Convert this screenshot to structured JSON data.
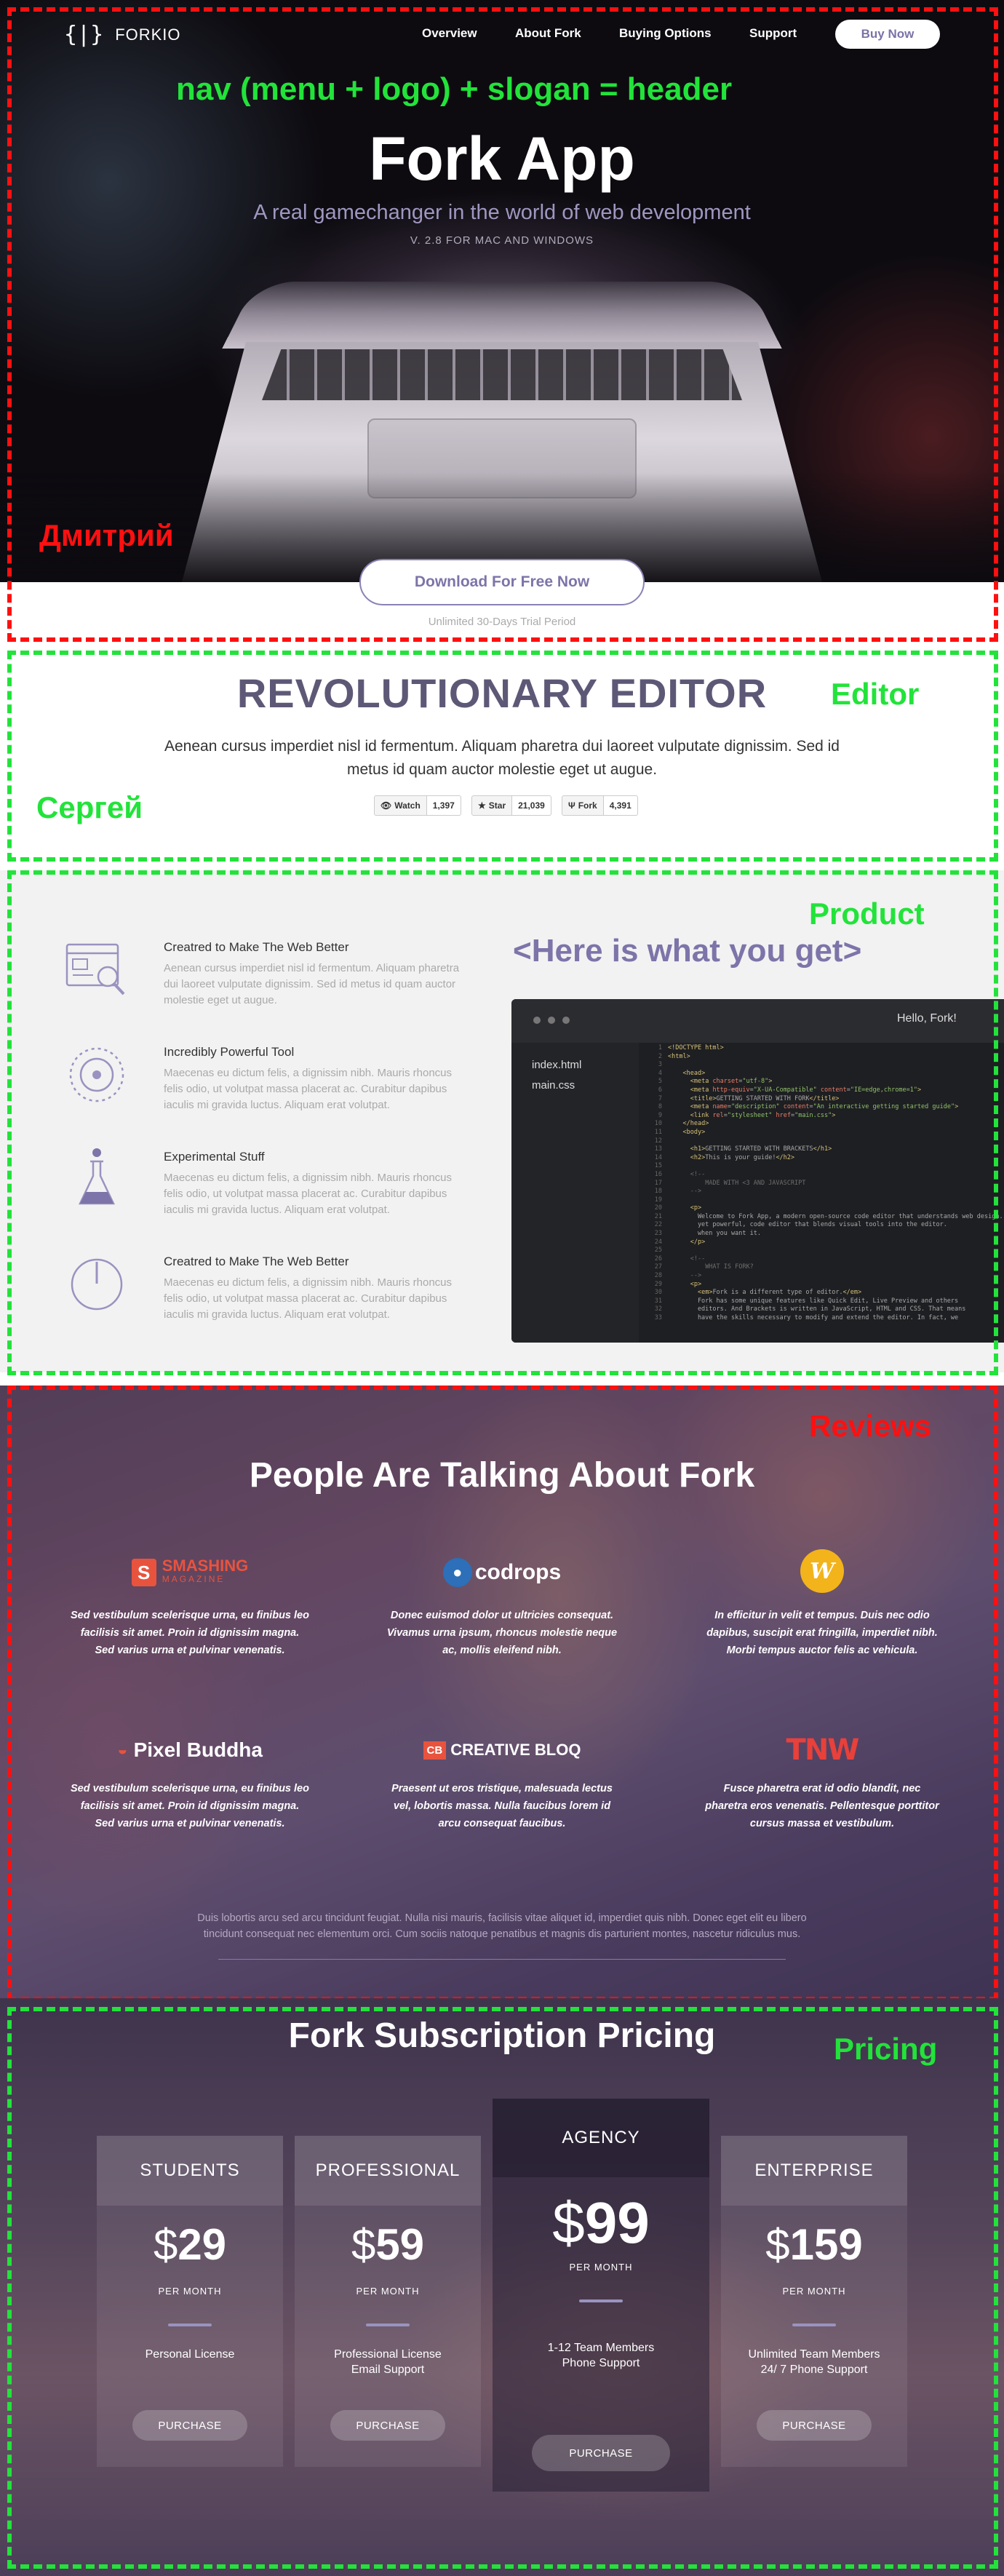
{
  "nav": {
    "logo_mark": "{|}",
    "logo_text": "FORKIO",
    "menu": [
      "Overview",
      "About Fork",
      "Buying Options",
      "Support"
    ],
    "buy_now": "Buy Now"
  },
  "annotations": {
    "header": "nav (menu + logo) + slogan = header",
    "header_author": "Дмитрий",
    "editor": "Editor",
    "editor_author": "Сергей",
    "product": "Product",
    "reviews": "Reviews",
    "pricing": "Pricing"
  },
  "hero": {
    "title": "Fork App",
    "subtitle": "A real gamechanger in the world of web development",
    "version": "V. 2.8 FOR MAC AND WINDOWS",
    "download": "Download For Free Now",
    "trial": "Unlimited 30-Days Trial Period"
  },
  "editor": {
    "title": "REVOLUTIONARY EDITOR",
    "text": "Aenean cursus imperdiet nisl id fermentum. Aliquam pharetra dui laoreet vulputate dignissim. Sed id metus id quam auctor molestie eget ut augue.",
    "github": [
      {
        "icon": "eye-icon",
        "label": "Watch",
        "count": "1,397"
      },
      {
        "icon": "star-icon",
        "label": "Star",
        "count": "21,039"
      },
      {
        "icon": "fork-icon",
        "label": "Fork",
        "count": "4,391"
      }
    ]
  },
  "product": {
    "heading": "<Here is what you get>",
    "features": [
      {
        "icon": "browser-magnifier-icon",
        "title": "Creatred to Make The Web Better",
        "text": "Aenean cursus imperdiet nisl id fermentum. Aliquam pharetra dui laoreet vulputate dignissim. Sed id metus id quam auctor molestie eget ut augue."
      },
      {
        "icon": "gauge-icon",
        "title": "Incredibly Powerful Tool",
        "text": "Maecenas eu dictum felis, a dignissim nibh. Mauris rhoncus felis odio, ut volutpat massa placerat ac. Curabitur dapibus iaculis mi gravida luctus. Aliquam erat volutpat."
      },
      {
        "icon": "flask-icon",
        "title": "Experimental Stuff",
        "text": "Maecenas eu dictum felis, a dignissim nibh. Mauris rhoncus felis odio, ut volutpat massa placerat ac. Curabitur dapibus iaculis mi gravida luctus. Aliquam erat volutpat."
      },
      {
        "icon": "power-icon",
        "title": "Creatred to Make The Web Better",
        "text": "Maecenas eu dictum felis, a dignissim nibh. Mauris rhoncus felis odio, ut volutpat massa placerat ac. Curabitur dapibus iaculis mi gravida luctus. Aliquam erat volutpat."
      }
    ],
    "window": {
      "title": "Hello, Fork!",
      "files": [
        "index.html",
        "main.css"
      ]
    }
  },
  "reviews": {
    "heading": "People Are Talking About Fork",
    "items": [
      {
        "logo": "SMASHING",
        "logo_sub": "MAGAZINE",
        "text": "Sed vestibulum scelerisque urna, eu finibus leo facilisis sit amet. Proin id dignissim magna. Sed varius urna et pulvinar venenatis."
      },
      {
        "logo": "codrops",
        "logo_sub": "",
        "text": "Donec euismod dolor ut ultricies consequat. Vivamus urna ipsum, rhoncus molestie neque ac, mollis eleifend nibh."
      },
      {
        "logo": "W",
        "logo_sub": "",
        "text": "In efficitur in velit et tempus. Duis nec odio dapibus, suscipit erat fringilla, imperdiet nibh. Morbi tempus auctor felis ac vehicula."
      },
      {
        "logo": "Pixel Buddha",
        "logo_sub": "",
        "text": "Sed vestibulum scelerisque urna, eu finibus leo facilisis sit amet. Proin id dignissim magna. Sed varius urna et pulvinar venenatis."
      },
      {
        "logo": "CREATIVE BLOQ",
        "logo_sub": "CB",
        "text": "Praesent ut eros tristique, malesuada lectus vel, lobortis massa. Nulla faucibus lorem id arcu consequat faucibus."
      },
      {
        "logo": "TNW",
        "logo_sub": "",
        "text": "Fusce pharetra erat id odio blandit, nec pharetra eros venenatis. Pellentesque porttitor cursus massa et vestibulum."
      }
    ],
    "footnote": "Duis lobortis arcu sed arcu tincidunt feugiat. Nulla nisi mauris, facilisis vitae aliquet id, imperdiet quis nibh. Donec eget elit eu libero tincidunt consequat nec elementum orci. Cum sociis natoque penatibus et magnis dis parturient montes, nascetur ridiculus mus."
  },
  "pricing": {
    "heading": "Fork Subscription Pricing",
    "plans": [
      {
        "name": "STUDENTS",
        "currency": "$",
        "price": "29",
        "period": "PER MONTH",
        "desc": [
          "Personal License"
        ],
        "cta": "PURCHASE"
      },
      {
        "name": "PROFESSIONAL",
        "currency": "$",
        "price": "59",
        "period": "PER MONTH",
        "desc": [
          "Professional License",
          "Email Support"
        ],
        "cta": "PURCHASE"
      },
      {
        "name": "AGENCY",
        "currency": "$",
        "price": "99",
        "period": "PER MONTH",
        "desc": [
          "1-12 Team Members",
          "Phone Support"
        ],
        "cta": "PURCHASE"
      },
      {
        "name": "ENTERPRISE",
        "currency": "$",
        "price": "159",
        "period": "PER MONTH",
        "desc": [
          "Unlimited Team Members",
          "24/ 7 Phone Support"
        ],
        "cta": "PURCHASE"
      }
    ]
  },
  "colors": {
    "accent": "#7d74a9",
    "annot_green": "#22e33a",
    "annot_red": "#ff1010"
  }
}
